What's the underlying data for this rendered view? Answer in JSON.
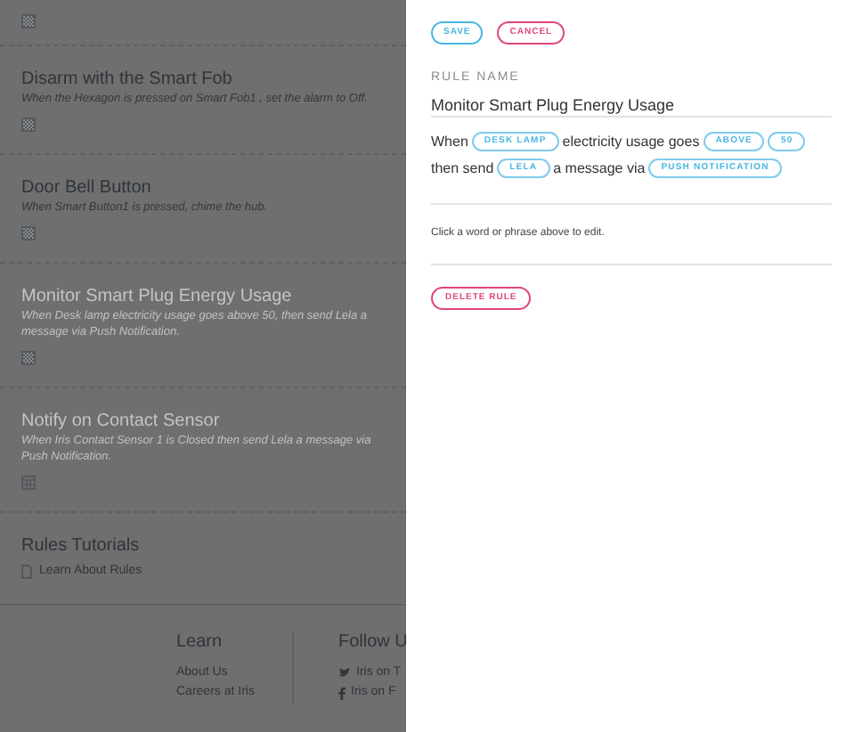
{
  "rules": [
    {
      "title": "Disarm with the Smart Fob",
      "description": "When the Hexagon is pressed on Smart Fob1 , set the alarm to Off.",
      "disabled": false
    },
    {
      "title": "Door Bell Button",
      "description": "When Smart Button1 is pressed, chime the hub.",
      "disabled": false
    },
    {
      "title": "Monitor Smart Plug Energy Usage",
      "description": "When Desk lamp electricity usage goes above 50, then send Lela a message via Push Notification.",
      "disabled": true
    },
    {
      "title": "Notify on Contact Sensor",
      "description": "When Iris Contact Sensor 1 is Closed then send Lela a message via Push Notification.",
      "disabled": true
    }
  ],
  "tutorials": {
    "title": "Rules Tutorials",
    "link": "Learn About Rules"
  },
  "footer": {
    "columns": [
      {
        "heading": "Learn",
        "links": [
          {
            "label": "About Us"
          },
          {
            "label": "Careers at Iris"
          }
        ]
      },
      {
        "heading": "Follow U",
        "links": [
          {
            "label": "Iris on T"
          },
          {
            "label": "Iris on F"
          }
        ]
      }
    ]
  },
  "editor": {
    "save": "SAVE",
    "cancel": "CANCEL",
    "name_label": "RULE NAME",
    "name_value": "Monitor Smart Plug Energy Usage",
    "sentence": [
      {
        "kind": "text",
        "text": "When"
      },
      {
        "kind": "chip",
        "text": "DESK LAMP"
      },
      {
        "kind": "text",
        "text": "electricity usage goes"
      },
      {
        "kind": "chip",
        "text": "ABOVE"
      },
      {
        "kind": "chip",
        "text": "50"
      },
      {
        "kind": "text",
        "text": "then send"
      },
      {
        "kind": "chip",
        "text": "LELA"
      },
      {
        "kind": "text",
        "text": "a message via"
      },
      {
        "kind": "chip",
        "text": "PUSH NOTIFICATION"
      }
    ],
    "hint": "Click a word or phrase above to edit.",
    "delete": "DELETE RULE"
  }
}
